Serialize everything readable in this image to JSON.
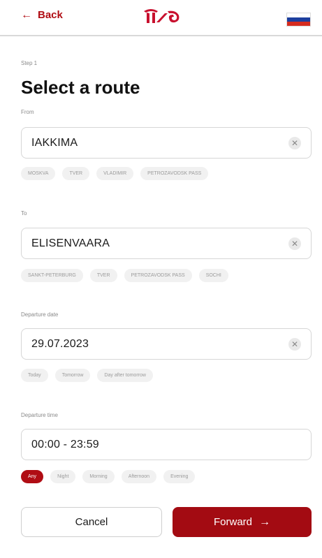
{
  "header": {
    "back_label": "Back",
    "back_icon": "arrow-left-icon",
    "logo_text": "РЖД",
    "flag_colors": [
      "#ffffff",
      "#1c3f9e",
      "#d52b1e"
    ]
  },
  "step_label": "Step 1",
  "title": "Select a route",
  "from": {
    "label": "From",
    "value": "IAKKIMA",
    "chips": [
      "MOSKVA",
      "TVER",
      "VLADIMIR",
      "PETROZAVODSK PASS"
    ]
  },
  "to": {
    "label": "To",
    "value": "ELISENVAARA",
    "chips": [
      "SANKT-PETERBURG",
      "TVER",
      "PETROZAVODSK PASS",
      "SOCHI"
    ]
  },
  "departure_date": {
    "label": "Departure date",
    "value": "29.07.2023",
    "chips": [
      "Today",
      "Tomorrow",
      "Day after tomorrow"
    ]
  },
  "departure_time": {
    "label": "Departure time",
    "value": "00:00 - 23:59",
    "chips": [
      "Any",
      "Night",
      "Morning",
      "Afternoon",
      "Evening"
    ],
    "selected": "Any"
  },
  "buttons": {
    "cancel": "Cancel",
    "forward": "Forward"
  },
  "colors": {
    "brand": "#b00d14",
    "forward_bg": "#a30b12"
  }
}
